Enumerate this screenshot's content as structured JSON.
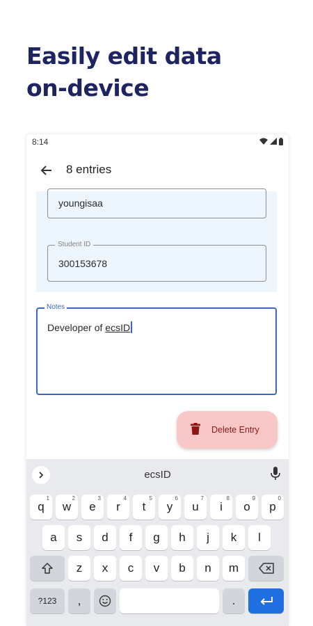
{
  "headline": {
    "line1": "Easily edit data",
    "line2": "on-device"
  },
  "status_bar": {
    "time": "8:14",
    "icons": [
      "wifi-icon",
      "signal-icon",
      "battery-icon"
    ]
  },
  "app_bar": {
    "title": "8 entries"
  },
  "fields": {
    "username_value": "youngisaa",
    "student_id_label": "Student ID",
    "student_id_value": "300153678"
  },
  "notes": {
    "label": "Notes",
    "text_prefix": "Developer of ",
    "text_underlined": "ecsID"
  },
  "delete_button": {
    "label": "Delete Entry"
  },
  "keyboard": {
    "suggestion": "ecsID",
    "row1": [
      {
        "key": "q",
        "hint": "1"
      },
      {
        "key": "w",
        "hint": "2"
      },
      {
        "key": "e",
        "hint": "3"
      },
      {
        "key": "r",
        "hint": "4"
      },
      {
        "key": "t",
        "hint": "5"
      },
      {
        "key": "y",
        "hint": "6"
      },
      {
        "key": "u",
        "hint": "7"
      },
      {
        "key": "i",
        "hint": "8"
      },
      {
        "key": "o",
        "hint": "9"
      },
      {
        "key": "p",
        "hint": "0"
      }
    ],
    "row2": [
      "a",
      "s",
      "d",
      "f",
      "g",
      "h",
      "j",
      "k",
      "l"
    ],
    "row3": [
      "z",
      "x",
      "c",
      "v",
      "b",
      "n",
      "m"
    ],
    "symbols_key": "?123",
    "comma_key": ",",
    "period_key": ".",
    "colors": {
      "enter_key": "#1f6fe0",
      "keyboard_bg": "#e8eaee"
    }
  },
  "colors": {
    "headline": "#1d2460",
    "accent": "#3a67c4",
    "delete_bg": "#f8c8c8",
    "delete_fg": "#8e1616"
  }
}
